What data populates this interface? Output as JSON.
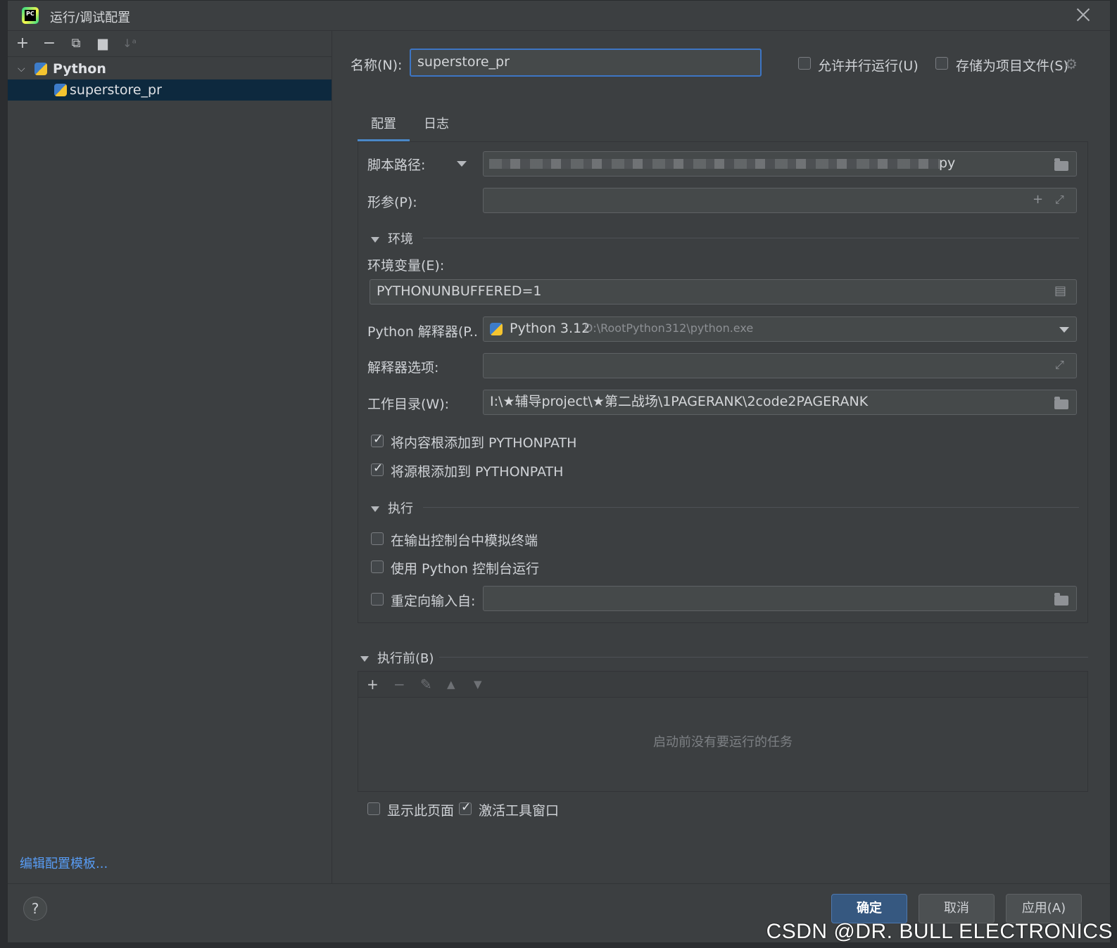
{
  "window": {
    "title": "运行/调试配置"
  },
  "tree": {
    "group": "Python",
    "item": "superstore_pr"
  },
  "left": {
    "edit_templates_link": "编辑配置模板..."
  },
  "header": {
    "name_label": "名称(N):",
    "name_value": "superstore_pr",
    "allow_parallel": "允许并行运行(U)",
    "store_as_project": "存储为项目文件(S)"
  },
  "tabs": [
    "配置",
    "日志"
  ],
  "config": {
    "script_label": "脚本路径:",
    "script_value_suffix": "py",
    "params_label": "形参(P):",
    "env_section": "环境",
    "env_vars_label": "环境变量(E):",
    "env_vars_value": "PYTHONUNBUFFERED=1",
    "interpreter_label": "Python 解释器(P..",
    "interpreter_value": "Python 3.12",
    "interpreter_path": "D:\\RootPython312\\python.exe",
    "interp_options_label": "解释器选项:",
    "workdir_label": "工作目录(W):",
    "workdir_value": "I:\\★辅导project\\★第二战场\\1PAGERANK\\2code2PAGERANK",
    "add_content_roots": "将内容根添加到 PYTHONPATH",
    "add_source_roots": "将源根添加到 PYTHONPATH",
    "exec_section": "执行",
    "emulate_terminal": "在输出控制台中模拟终端",
    "use_python_console": "使用 Python 控制台运行",
    "redirect_input": "重定向输入自:"
  },
  "before_launch": {
    "section": "执行前(B)",
    "empty_text": "启动前没有要运行的任务",
    "show_page": "显示此页面",
    "activate_tool_window": "激活工具窗口"
  },
  "buttons": {
    "ok": "确定",
    "cancel": "取消",
    "apply": "应用(A)",
    "help": "?"
  },
  "watermark": "CSDN @DR. BULL ELECTRONICS",
  "colors": {
    "accent": "#4a88c7",
    "selection": "#0d293e",
    "link": "#589df6",
    "primary_button": "#365880"
  }
}
